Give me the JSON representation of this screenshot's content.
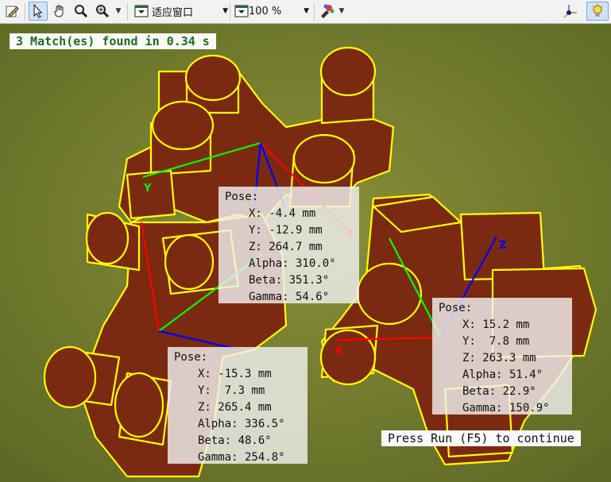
{
  "toolbar": {
    "fit_label": "适应窗口",
    "zoom_label": "100 %"
  },
  "overlay": {
    "status": "3 Match(es) found in 0.34 s",
    "continue_hint": "Press Run (F5) to continue"
  },
  "poses": [
    {
      "title": "Pose:",
      "x": "X: -4.4 mm",
      "y": "Y: -12.9 mm",
      "z": "Z: 264.7 mm",
      "alpha": "Alpha: 310.0°",
      "beta": "Beta: 351.3°",
      "gamma": "Gamma: 54.6°"
    },
    {
      "title": "Pose:",
      "x": "X: -15.3 mm",
      "y": "Y:  7.3 mm",
      "z": "Z: 265.4 mm",
      "alpha": "Alpha: 336.5°",
      "beta": "Beta: 48.6°",
      "gamma": "Gamma: 254.8°"
    },
    {
      "title": "Pose:",
      "x": "X: 15.2 mm",
      "y": "Y:  7.8 mm",
      "z": "Z: 263.3 mm",
      "alpha": "Alpha: 51.4°",
      "beta": "Beta: 22.9°",
      "gamma": "Gamma: 150.9°"
    }
  ],
  "axis_labels": {
    "y": "Y",
    "x": "X",
    "z": "Z"
  },
  "colors": {
    "contour": "#ffff00",
    "axis_x": "#ff0000",
    "axis_y": "#00ff00",
    "axis_z": "#0000ff",
    "status_text": "#1e6b1e"
  },
  "icons": [
    "edit-icon",
    "pointer-icon",
    "hand-pan-icon",
    "magnifier-icon",
    "zoom-in-icon",
    "fit-window-icon",
    "zoom-level-icon",
    "color-brush-icon",
    "axes-icon",
    "bulb-icon"
  ]
}
